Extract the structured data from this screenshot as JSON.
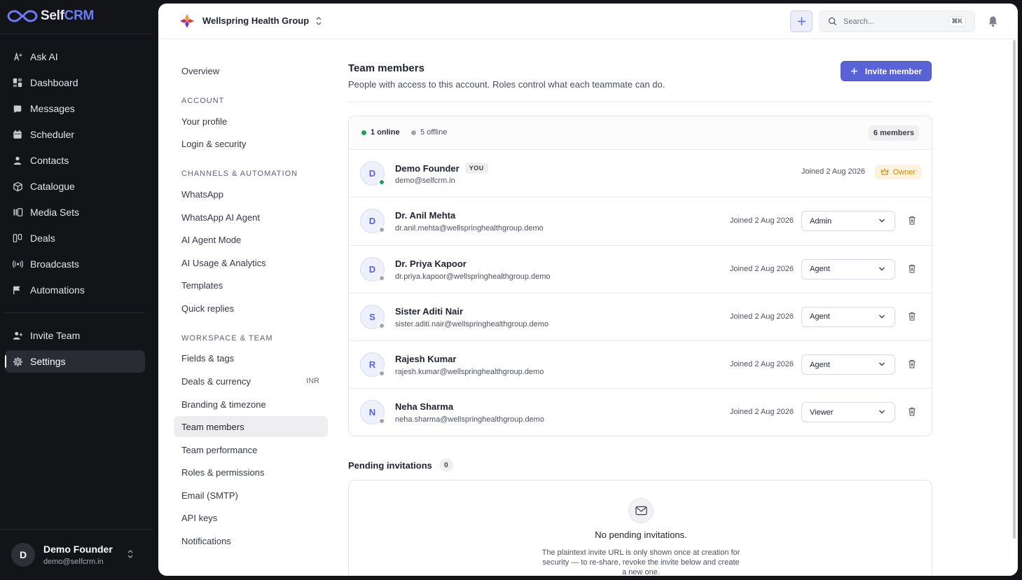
{
  "brand": {
    "self": "Self",
    "crm": "CRM"
  },
  "nav": [
    {
      "id": "ask-ai",
      "label": "Ask AI",
      "icon": "sparkle-icon"
    },
    {
      "id": "dashboard",
      "label": "Dashboard",
      "icon": "dashboard-icon"
    },
    {
      "id": "messages",
      "label": "Messages",
      "icon": "messages-icon"
    },
    {
      "id": "scheduler",
      "label": "Scheduler",
      "icon": "calendar-icon"
    },
    {
      "id": "contacts",
      "label": "Contacts",
      "icon": "person-icon"
    },
    {
      "id": "catalogue",
      "label": "Catalogue",
      "icon": "box-icon"
    },
    {
      "id": "media-sets",
      "label": "Media Sets",
      "icon": "media-icon"
    },
    {
      "id": "deals",
      "label": "Deals",
      "icon": "deals-icon"
    },
    {
      "id": "broadcasts",
      "label": "Broadcasts",
      "icon": "broadcast-icon"
    },
    {
      "id": "automations",
      "label": "Automations",
      "icon": "flag-icon"
    }
  ],
  "nav_bottom": [
    {
      "id": "invite-team",
      "label": "Invite Team",
      "icon": "user-plus-icon"
    },
    {
      "id": "settings",
      "label": "Settings",
      "icon": "gear-icon",
      "active": true
    }
  ],
  "user": {
    "initial": "D",
    "name": "Demo Founder",
    "email": "demo@selfcrm.in"
  },
  "topbar": {
    "org_name": "Wellspring Health Group",
    "search_placeholder": "Search...",
    "search_shortcut": "⌘K"
  },
  "settings_nav": {
    "overview": "Overview",
    "sections": [
      {
        "heading": "ACCOUNT",
        "items": [
          "Your profile",
          "Login & security"
        ]
      },
      {
        "heading": "CHANNELS & AUTOMATION",
        "items": [
          "WhatsApp",
          "WhatsApp AI Agent",
          "AI Agent Mode",
          "AI Usage & Analytics",
          "Templates",
          "Quick replies"
        ]
      },
      {
        "heading": "WORKSPACE & TEAM",
        "items": [
          "Fields & tags",
          "Deals & currency",
          "Branding & timezone",
          "Team members",
          "Team performance",
          "Roles & permissions",
          "Email (SMTP)",
          "API keys",
          "Notifications"
        ]
      }
    ],
    "active_item": "Team members",
    "currency_badge": "INR"
  },
  "team": {
    "title": "Team members",
    "description": "People with access to this account. Roles control what each teammate can do.",
    "invite_label": "Invite member",
    "online_label": "1 online",
    "offline_label": "5 offline",
    "count_label": "6 members",
    "you_tag": "YOU",
    "owner_label": "Owner",
    "members": [
      {
        "initial": "D",
        "name": "Demo Founder",
        "email": "demo@selfcrm.in",
        "joined": "Joined 2 Aug 2026",
        "role": "Owner",
        "online": true,
        "is_you": true
      },
      {
        "initial": "D",
        "name": "Dr. Anil Mehta",
        "email": "dr.anil.mehta@wellspringhealthgroup.demo",
        "joined": "Joined 2 Aug 2026",
        "role": "Admin",
        "online": false
      },
      {
        "initial": "D",
        "name": "Dr. Priya Kapoor",
        "email": "dr.priya.kapoor@wellspringhealthgroup.demo",
        "joined": "Joined 2 Aug 2026",
        "role": "Agent",
        "online": false
      },
      {
        "initial": "S",
        "name": "Sister Aditi Nair",
        "email": "sister.aditi.nair@wellspringhealthgroup.demo",
        "joined": "Joined 2 Aug 2026",
        "role": "Agent",
        "online": false
      },
      {
        "initial": "R",
        "name": "Rajesh Kumar",
        "email": "rajesh.kumar@wellspringhealthgroup.demo",
        "joined": "Joined 2 Aug 2026",
        "role": "Agent",
        "online": false
      },
      {
        "initial": "N",
        "name": "Neha Sharma",
        "email": "neha.sharma@wellspringhealthgroup.demo",
        "joined": "Joined 2 Aug 2026",
        "role": "Viewer",
        "online": false
      }
    ]
  },
  "pending": {
    "title": "Pending invitations",
    "count": "0",
    "empty_title": "No pending invitations.",
    "note": "The plaintext invite URL is only shown once at creation for security — to re-share, revoke the invite below and create a new one."
  },
  "colors": {
    "accent": "#5a63d6",
    "online": "#22a05a",
    "offline": "#a3a5ad",
    "owner": "#c98a14",
    "sidebar_bg": "#131418"
  }
}
